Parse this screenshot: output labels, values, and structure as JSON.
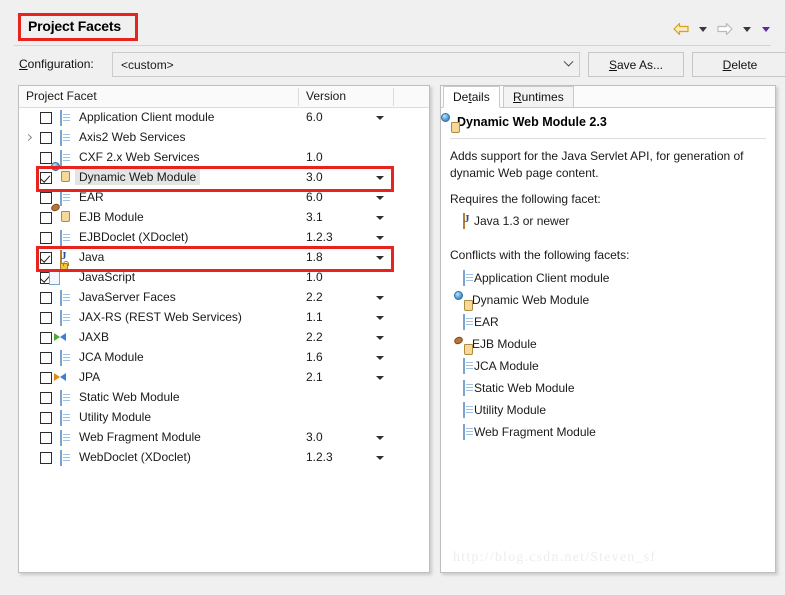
{
  "window": {
    "title": "Project Facets",
    "watermark": "http://blog.csdn.net/Steven_sf"
  },
  "nav": {
    "back_icon": "back-arrow-icon",
    "back_menu_icon": "chevron-down-icon",
    "forward_icon": "forward-arrow-icon",
    "forward_menu_icon": "chevron-down-icon",
    "extra_menu_icon": "chevron-down-icon"
  },
  "configuration": {
    "label": "Configuration:",
    "label_mnemonic": "C",
    "label_rest": "onfiguration:",
    "value": "<custom>",
    "dropdown_icon": "chevron-down-icon"
  },
  "buttons": {
    "save_as": {
      "mnemonic": "S",
      "rest": "ave As..."
    },
    "delete": {
      "mnemonic": "D",
      "rest": "elete"
    }
  },
  "facet_table": {
    "columns": [
      "Project Facet",
      "Version"
    ],
    "rows": [
      {
        "label": "Application Client module",
        "version": "6.0",
        "checked": false,
        "icon": "document-icon",
        "has_version_caret": true,
        "expandable": false,
        "selected": false
      },
      {
        "label": "Axis2 Web Services",
        "version": "",
        "checked": false,
        "icon": "document-icon",
        "has_version_caret": false,
        "expandable": true,
        "selected": false
      },
      {
        "label": "CXF 2.x Web Services",
        "version": "1.0",
        "checked": false,
        "icon": "document-icon",
        "has_version_caret": false,
        "expandable": false,
        "selected": false
      },
      {
        "label": "Dynamic Web Module",
        "version": "3.0",
        "checked": true,
        "icon": "jar-web-icon",
        "has_version_caret": true,
        "expandable": false,
        "selected": true
      },
      {
        "label": "EAR",
        "version": "6.0",
        "checked": false,
        "icon": "document-icon",
        "has_version_caret": true,
        "expandable": false,
        "selected": false
      },
      {
        "label": "EJB Module",
        "version": "3.1",
        "checked": false,
        "icon": "jar-bean-icon",
        "has_version_caret": true,
        "expandable": false,
        "selected": false
      },
      {
        "label": "EJBDoclet (XDoclet)",
        "version": "1.2.3",
        "checked": false,
        "icon": "document-icon",
        "has_version_caret": true,
        "expandable": false,
        "selected": false
      },
      {
        "label": "Java",
        "version": "1.8",
        "checked": true,
        "icon": "java-icon",
        "has_version_caret": true,
        "expandable": false,
        "selected": false
      },
      {
        "label": "JavaScript",
        "version": "1.0",
        "checked": true,
        "icon": "javascript-lock-icon",
        "has_version_caret": false,
        "expandable": false,
        "selected": false
      },
      {
        "label": "JavaServer Faces",
        "version": "2.2",
        "checked": false,
        "icon": "document-icon",
        "has_version_caret": true,
        "expandable": false,
        "selected": false
      },
      {
        "label": "JAX-RS (REST Web Services)",
        "version": "1.1",
        "checked": false,
        "icon": "document-icon",
        "has_version_caret": true,
        "expandable": false,
        "selected": false
      },
      {
        "label": "JAXB",
        "version": "2.2",
        "checked": false,
        "icon": "arrows-green-icon",
        "has_version_caret": true,
        "expandable": false,
        "selected": false
      },
      {
        "label": "JCA Module",
        "version": "1.6",
        "checked": false,
        "icon": "document-icon",
        "has_version_caret": true,
        "expandable": false,
        "selected": false
      },
      {
        "label": "JPA",
        "version": "2.1",
        "checked": false,
        "icon": "arrows-orange-icon",
        "has_version_caret": true,
        "expandable": false,
        "selected": false
      },
      {
        "label": "Static Web Module",
        "version": "",
        "checked": false,
        "icon": "document-icon",
        "has_version_caret": false,
        "expandable": false,
        "selected": false
      },
      {
        "label": "Utility Module",
        "version": "",
        "checked": false,
        "icon": "document-icon",
        "has_version_caret": false,
        "expandable": false,
        "selected": false
      },
      {
        "label": "Web Fragment Module",
        "version": "3.0",
        "checked": false,
        "icon": "document-icon",
        "has_version_caret": true,
        "expandable": false,
        "selected": false
      },
      {
        "label": "WebDoclet (XDoclet)",
        "version": "1.2.3",
        "checked": false,
        "icon": "document-icon",
        "has_version_caret": true,
        "expandable": false,
        "selected": false
      }
    ]
  },
  "highlights": {
    "color": "#e8221d",
    "regions": [
      "title",
      "row-dynamic-web-module",
      "row-java"
    ]
  },
  "details": {
    "tabs": [
      {
        "label": "Details",
        "mnemonic": "t",
        "pre": "De",
        "post": "ails",
        "active": true
      },
      {
        "label": "Runtimes",
        "mnemonic": "R",
        "pre": "",
        "post": "untimes",
        "active": false
      }
    ],
    "heading": "Dynamic Web Module 2.3",
    "heading_icon": "jar-web-icon",
    "description": "Adds support for the Java Servlet API, for generation of dynamic Web page content.",
    "requires_label": "Requires the following facet:",
    "requires": [
      {
        "label": "Java 1.3 or newer",
        "icon": "java-icon"
      }
    ],
    "conflicts_label": "Conflicts with the following facets:",
    "conflicts": [
      {
        "label": "Application Client module",
        "icon": "document-icon"
      },
      {
        "label": "Dynamic Web Module",
        "icon": "jar-web-icon"
      },
      {
        "label": "EAR",
        "icon": "document-icon"
      },
      {
        "label": "EJB Module",
        "icon": "jar-bean-icon"
      },
      {
        "label": "JCA Module",
        "icon": "document-icon"
      },
      {
        "label": "Static Web Module",
        "icon": "document-icon"
      },
      {
        "label": "Utility Module",
        "icon": "document-icon"
      },
      {
        "label": "Web Fragment Module",
        "icon": "document-icon"
      }
    ]
  }
}
